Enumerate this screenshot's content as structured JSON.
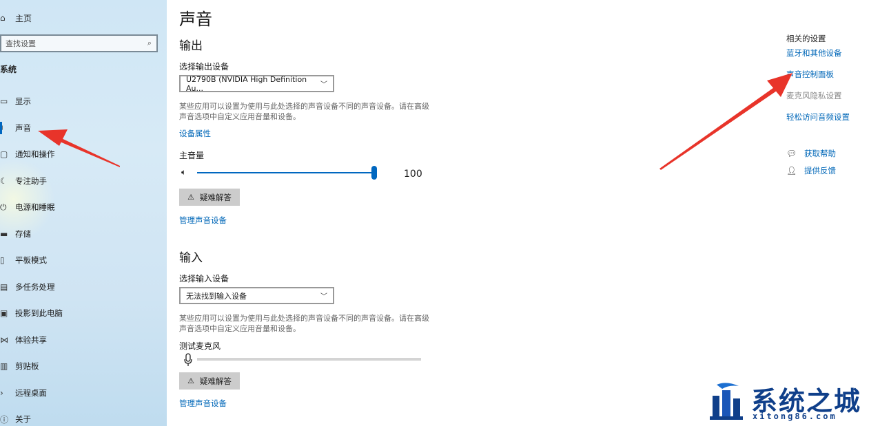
{
  "sidebar": {
    "home_label": "主页",
    "search_placeholder": "查找设置",
    "section_label": "系统",
    "items": [
      {
        "label": "显示",
        "icon": "display-icon"
      },
      {
        "label": "声音",
        "icon": "speaker-icon"
      },
      {
        "label": "通知和操作",
        "icon": "notification-icon"
      },
      {
        "label": "专注助手",
        "icon": "moon-icon"
      },
      {
        "label": "电源和睡眠",
        "icon": "power-icon"
      },
      {
        "label": "存储",
        "icon": "storage-icon"
      },
      {
        "label": "平板模式",
        "icon": "tablet-icon"
      },
      {
        "label": "多任务处理",
        "icon": "multitask-icon"
      },
      {
        "label": "投影到此电脑",
        "icon": "project-icon"
      },
      {
        "label": "体验共享",
        "icon": "share-icon"
      },
      {
        "label": "剪贴板",
        "icon": "clipboard-icon"
      },
      {
        "label": "远程桌面",
        "icon": "remote-desktop-icon"
      },
      {
        "label": "关于",
        "icon": "info-icon"
      }
    ],
    "active_index": 1
  },
  "main": {
    "title": "声音",
    "output": {
      "heading": "输出",
      "select_label": "选择输出设备",
      "selected_device": "U2790B (NVIDIA High Definition Au...",
      "hint": "某些应用可以设置为使用与此处选择的声音设备不同的声音设备。请在高级声音选项中自定义应用音量和设备。",
      "properties_link": "设备属性",
      "volume_label": "主音量",
      "volume_value": "100",
      "volume_percent": 100,
      "troubleshoot_label": "疑难解答",
      "manage_link": "管理声音设备"
    },
    "input": {
      "heading": "输入",
      "select_label": "选择输入设备",
      "selected_device": "无法找到输入设备",
      "hint": "某些应用可以设置为使用与此处选择的声音设备不同的声音设备。请在高级声音选项中自定义应用音量和设备。",
      "test_label": "测试麦克风",
      "troubleshoot_label": "疑难解答",
      "manage_link": "管理声音设备"
    }
  },
  "related": {
    "title": "相关的设置",
    "links": [
      {
        "label": "蓝牙和其他设备",
        "style": "link"
      },
      {
        "label": "声音控制面板",
        "style": "link"
      },
      {
        "label": "麦克风隐私设置",
        "style": "muted"
      },
      {
        "label": "轻松访问音频设置",
        "style": "link"
      }
    ],
    "help": [
      {
        "label": "获取帮助",
        "icon": "help-chat-icon"
      },
      {
        "label": "提供反馈",
        "icon": "feedback-icon"
      }
    ]
  },
  "watermark": {
    "brand": "系统之城",
    "url": "xitong86.com"
  },
  "colors": {
    "accent": "#0067c0",
    "link": "#0067b8",
    "arrow": "#e8342a",
    "sidebar_bg": "#d3e8f5",
    "watermark": "#0f3f8a"
  }
}
